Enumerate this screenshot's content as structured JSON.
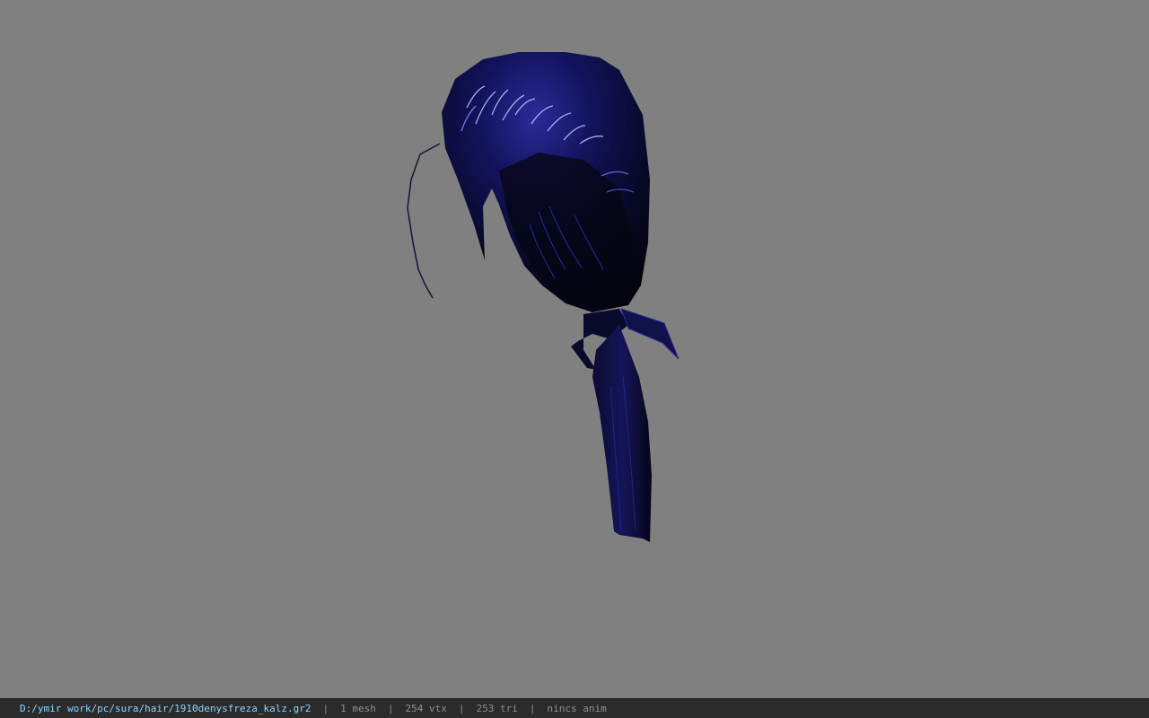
{
  "viewport": {
    "background": "#808080",
    "model_colors": {
      "base": "#07071a",
      "mid": "#101046",
      "highlight": "#3a3ad0",
      "specular": "#c8c8ff"
    }
  },
  "status_bar": {
    "file_path": "D:/ymir work/pc/sura/hair/1910denysfreza_kalz.gr2",
    "separator": "|",
    "mesh_count": "1 mesh",
    "vertex_count": "254 vtx",
    "triangle_count": "253 tri",
    "anim_status": "nincs anim",
    "path_color": "#8fd4ff"
  }
}
